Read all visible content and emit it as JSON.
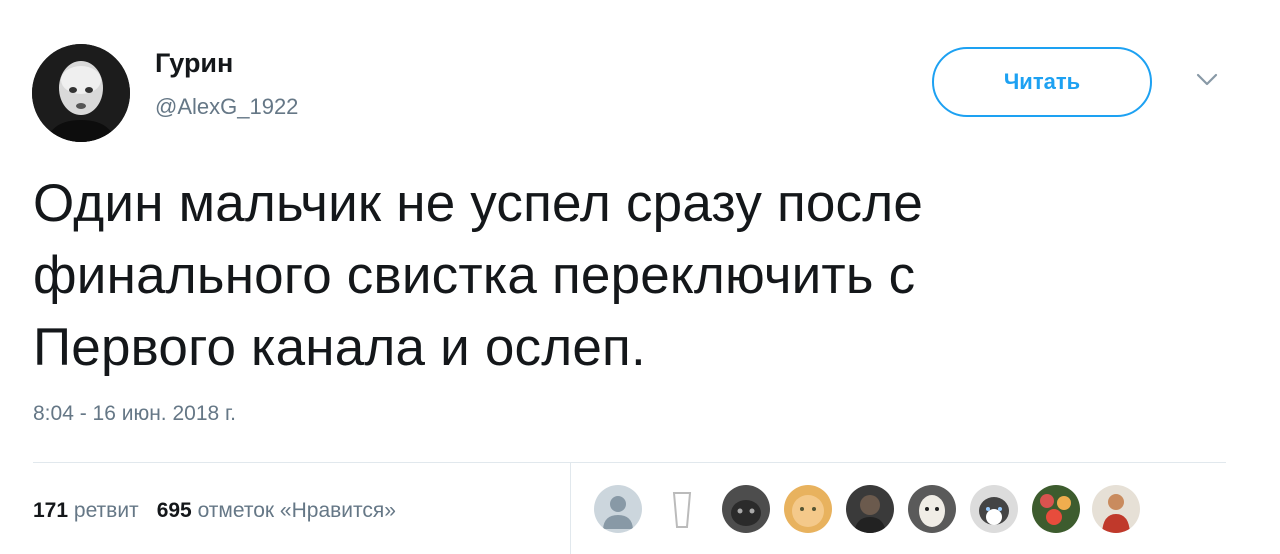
{
  "user": {
    "name": "Гурин",
    "handle": "@AlexG_1922"
  },
  "follow_button": {
    "label": "Читать"
  },
  "tweet": {
    "lines": [
      "Один мальчик не успел сразу после",
      "финального свистка переключить с",
      "Первого канала и ослеп."
    ],
    "timestamp": "8:04 - 16 июн. 2018 г."
  },
  "stats": {
    "retweets_count": "171",
    "retweets_label": "ретвит",
    "likes_count": "695",
    "likes_label": "отметок «Нравится»"
  },
  "likers": [
    {
      "icon": "default-avatar-icon"
    },
    {
      "icon": "glass-avatar-icon"
    },
    {
      "icon": "cat-avatar-icon"
    },
    {
      "icon": "baby-face-avatar-icon"
    },
    {
      "icon": "man-avatar-icon"
    },
    {
      "icon": "alpaca-avatar-icon"
    },
    {
      "icon": "husky-avatar-icon"
    },
    {
      "icon": "flowers-avatar-icon"
    },
    {
      "icon": "person-red-avatar-icon"
    }
  ],
  "colors": {
    "accent": "#1da1f2",
    "text": "#14171a",
    "secondary": "#657786",
    "divider": "#e1e8ed"
  }
}
